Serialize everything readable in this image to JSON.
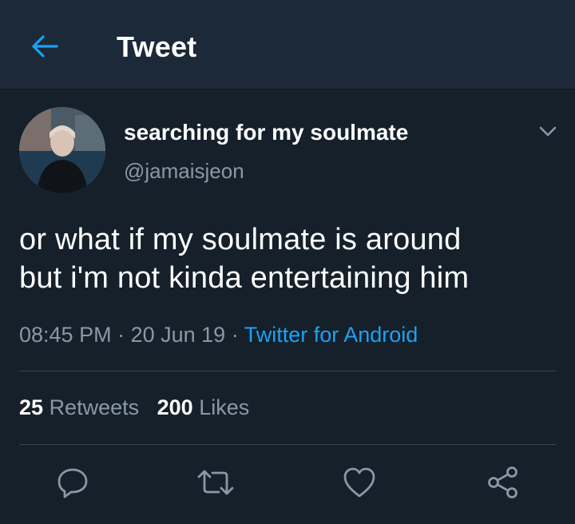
{
  "header": {
    "title": "Tweet",
    "back_icon": "back-arrow-icon",
    "accent": "#1da1f2"
  },
  "tweet": {
    "display_name": "searching for my soulmate",
    "handle": "@jamaisjeon",
    "text_line1": "or what if my soulmate is around",
    "text_line2": "but i'm not kinda entertaining him",
    "time": "08:45 PM",
    "separator1": " · ",
    "date": "20 Jun 19",
    "separator2": " · ",
    "source": "Twitter for Android"
  },
  "stats": {
    "retweets_count": "25",
    "retweets_label": "Retweets",
    "likes_count": "200",
    "likes_label": "Likes"
  },
  "actions": [
    "reply-icon",
    "retweet-icon",
    "like-icon",
    "share-icon"
  ],
  "colors": {
    "background": "#15202b",
    "header": "#1c2938",
    "muted": "#8899a6",
    "link": "#1da1f2"
  }
}
